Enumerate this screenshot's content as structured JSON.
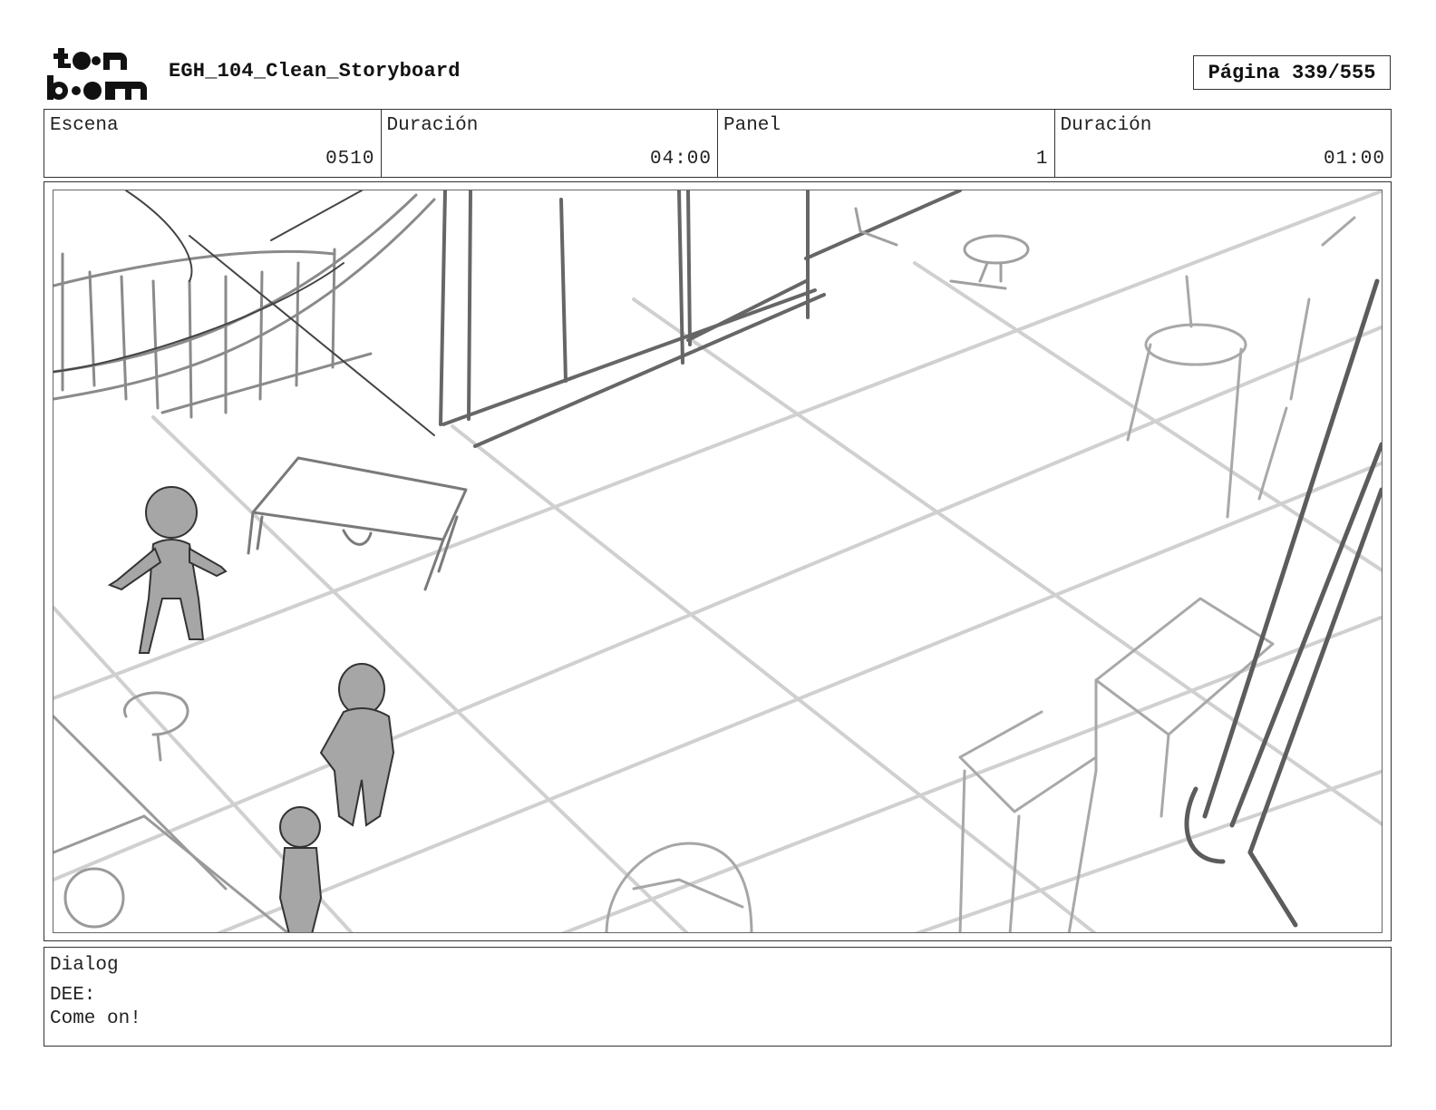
{
  "header": {
    "logo_text_top": "toon",
    "logo_text_bottom": "boom",
    "document_title": "EGH_104_Clean_Storyboard",
    "page_label": "Página 339/555"
  },
  "info": {
    "scene_label": "Escena",
    "scene_value": "0510",
    "scene_duration_label": "Duración",
    "scene_duration_value": "04:00",
    "panel_label": "Panel",
    "panel_value": "1",
    "panel_duration_label": "Duración",
    "panel_duration_value": "01:00"
  },
  "dialog": {
    "label": "Dialog",
    "speaker": "DEE:",
    "line": "Come on!"
  },
  "colors": {
    "sketch_dark": "#555555",
    "sketch_mid": "#8a8a8a",
    "sketch_light": "#c9c9c9",
    "character_fill": "#a6a6a6"
  }
}
